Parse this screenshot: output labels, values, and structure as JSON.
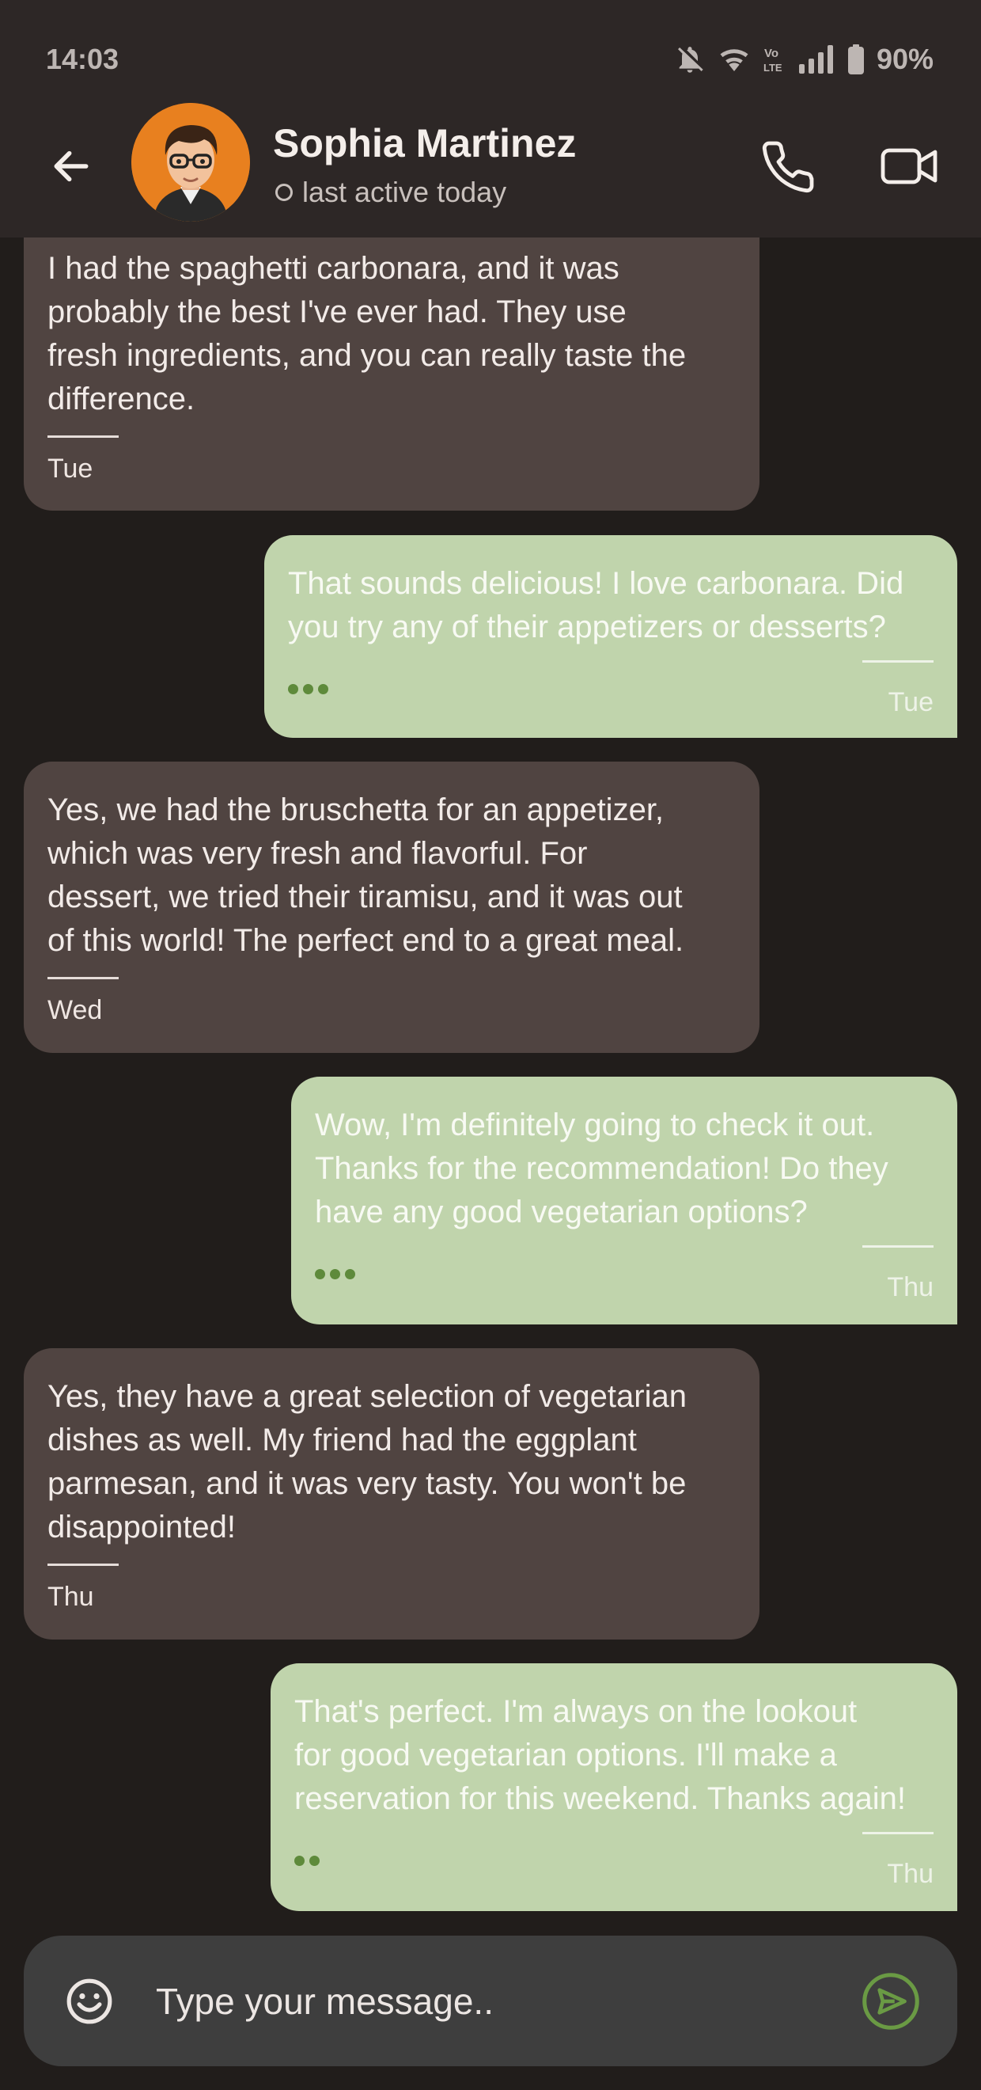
{
  "status_bar": {
    "time": "14:03",
    "volte": "Vo LTE",
    "battery": "90%",
    "icons": [
      "bell-off-icon",
      "wifi-icon",
      "volte-icon",
      "signal-icon",
      "battery-icon"
    ]
  },
  "header": {
    "name": "Sophia Martinez",
    "status": "last active today",
    "icons": [
      "back-arrow-icon",
      "avatar",
      "phone-icon",
      "video-camera-icon"
    ]
  },
  "messages": [
    {
      "direction": "in",
      "text": "I had the spaghetti carbonara, and it was\nprobably the best I've ever had. They use\nfresh ingredients, and you can really taste the\ndifference.",
      "time": "Tue"
    },
    {
      "direction": "out",
      "text": "That sounds delicious! I love carbonara. Did\nyou try any of their appetizers or desserts?",
      "time": "Tue",
      "delivery": "three-dots"
    },
    {
      "direction": "in",
      "text": "Yes, we had the bruschetta for an appetizer,\nwhich was very fresh and flavorful. For\ndessert, we tried their tiramisu, and it was out\nof this world! The perfect end to a great meal.",
      "time": "Wed"
    },
    {
      "direction": "out",
      "text": "Wow, I'm definitely going to check it out.\nThanks for the recommendation! Do they\nhave any good vegetarian options?",
      "time": "Thu",
      "delivery": "three-dots"
    },
    {
      "direction": "in",
      "text": "Yes, they have a great selection of vegetarian\ndishes as well. My friend had the eggplant\nparmesan, and it was very tasty. You won't be\ndisappointed!",
      "time": "Thu"
    },
    {
      "direction": "out",
      "text": "That's perfect. I'm always on the lookout\nfor good vegetarian options. I'll make a\nreservation for this weekend. Thanks again!",
      "time": "Thu",
      "delivery": "two-dots"
    }
  ],
  "composer": {
    "placeholder": "Type your message..",
    "icons": [
      "emoji-icon",
      "send-icon"
    ]
  },
  "colors": {
    "background": "#211d1b",
    "header": "#2d2726",
    "incoming_bubble": "#504441",
    "outgoing_bubble": "#c0d4ac",
    "accent_green": "#5e8a3b",
    "avatar_bg": "#e8801f"
  }
}
